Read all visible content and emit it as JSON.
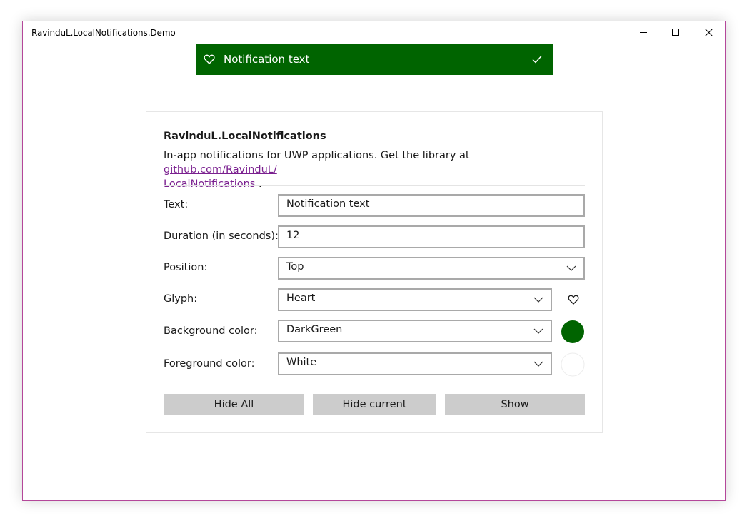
{
  "window": {
    "title": "RavinduL.LocalNotifications.Demo",
    "controls": [
      "minimize-icon",
      "maximize-icon",
      "close-icon"
    ]
  },
  "notification": {
    "text": "Notification text",
    "glyph": "heart-icon",
    "dismiss_icon": "checkmark-icon",
    "background": "#006400",
    "foreground": "#FFFFFF"
  },
  "card": {
    "title": "RavinduL.LocalNotifications",
    "description": "In-app notifications for UWP applications. Get the library at",
    "link_text": "github.com/RavinduL/ LocalNotifications",
    "link_suffix": "."
  },
  "form": {
    "text": {
      "label": "Text:",
      "value": "Notification text"
    },
    "duration": {
      "label": "Duration (in seconds):",
      "value": "12"
    },
    "position": {
      "label": "Position:",
      "value": "Top"
    },
    "glyph": {
      "label": "Glyph:",
      "value": "Heart",
      "preview_icon": "heart-icon"
    },
    "background": {
      "label": "Background color:",
      "value": "DarkGreen",
      "swatch": "#006400"
    },
    "foreground": {
      "label": "Foreground color:",
      "value": "White",
      "swatch": "#FFFFFF"
    }
  },
  "buttons": {
    "hide_all": "Hide All",
    "hide_current": "Hide current",
    "show": "Show"
  }
}
